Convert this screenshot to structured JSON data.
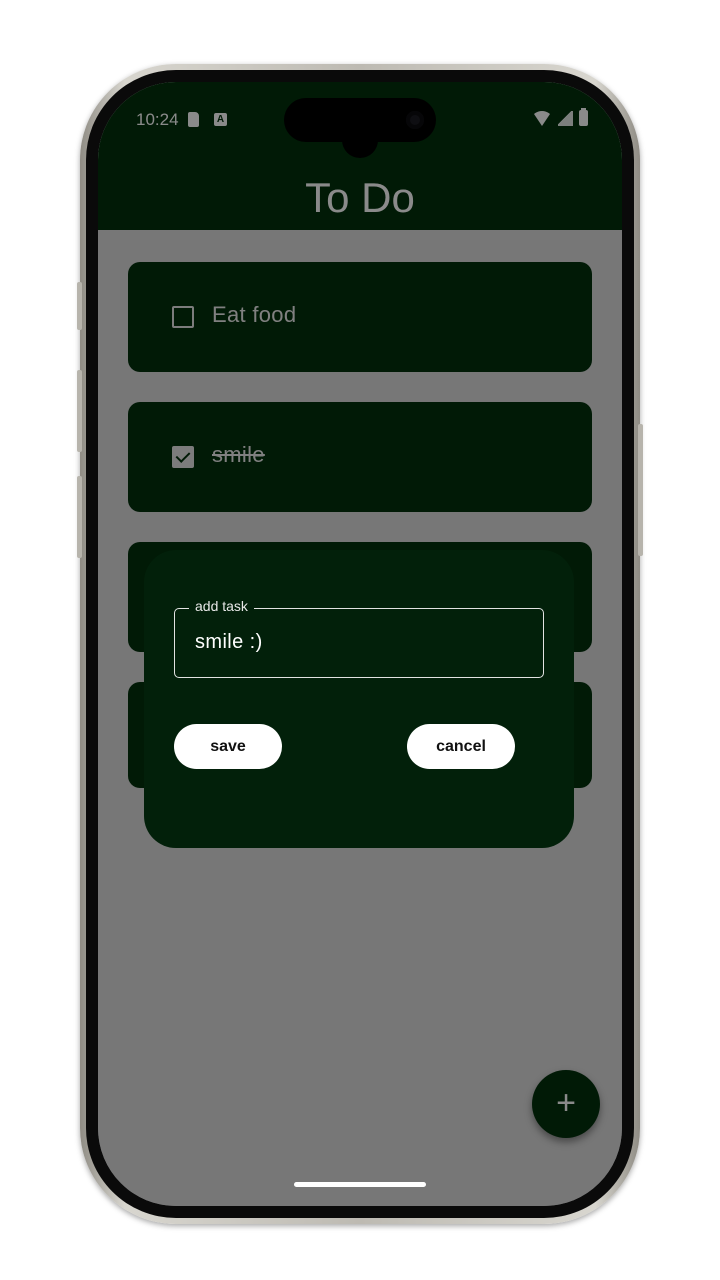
{
  "status_bar": {
    "time": "10:24",
    "icons": [
      "sd-card-icon",
      "keyboard-a-icon",
      "wifi-icon",
      "signal-icon",
      "battery-icon"
    ]
  },
  "app": {
    "title": "To Do",
    "colors": {
      "primary": "#02300c",
      "dialog": "#02200a",
      "scrim": "rgba(0,0,0,0.46)",
      "button": "#ffffff"
    }
  },
  "tasks": [
    {
      "text": "Eat food",
      "done": false
    },
    {
      "text": "smile",
      "done": true
    },
    {
      "text": "",
      "done": false
    },
    {
      "text": "",
      "done": false
    }
  ],
  "dialog": {
    "field_label": "add task",
    "field_value": "smile :)",
    "save_label": "save",
    "cancel_label": "cancel"
  },
  "fab": {
    "icon": "plus-icon",
    "glyph": "+"
  }
}
